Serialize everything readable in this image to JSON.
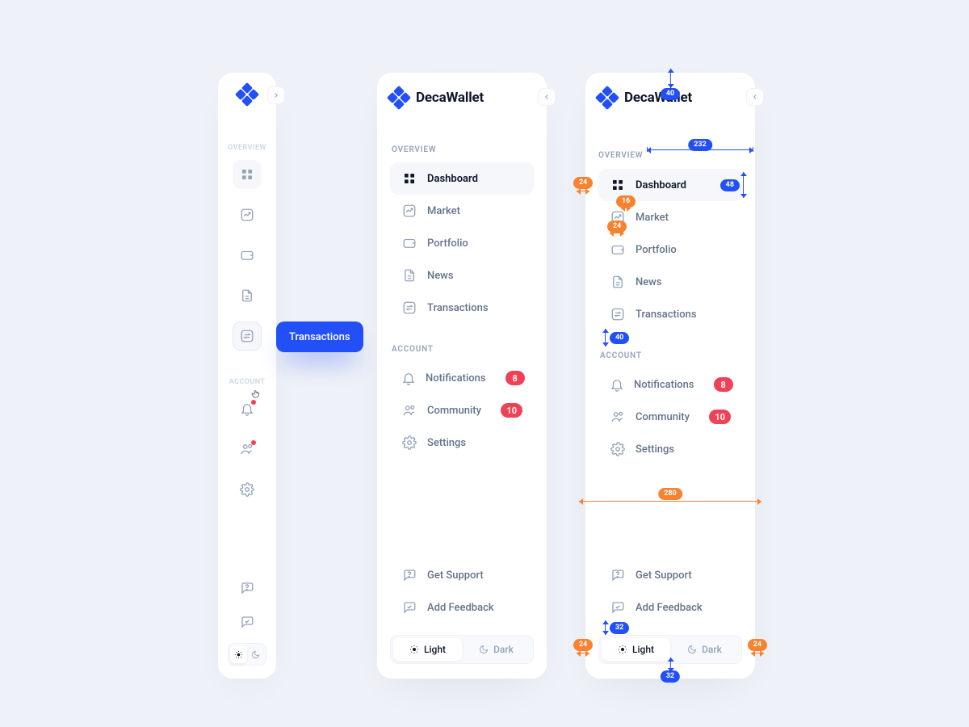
{
  "brand": {
    "name": "DecaWallet"
  },
  "sections": {
    "overview": "OVERVIEW",
    "account": "ACCOUNT"
  },
  "nav": {
    "dashboard": "Dashboard",
    "market": "Market",
    "portfolio": "Portfolio",
    "news": "News",
    "transactions": "Transactions",
    "notifications": "Notifications",
    "community": "Community",
    "settings": "Settings",
    "support": "Get Support",
    "feedback": "Add Feedback"
  },
  "badges": {
    "notifications": "8",
    "community": "10"
  },
  "theme": {
    "light": "Light",
    "dark": "Dark"
  },
  "collapsed_tooltip": {
    "label_path": "nav.transactions"
  },
  "spec": {
    "top_gap": "40",
    "row_w": "232",
    "row_h": "48",
    "side_pad": "24",
    "icon_gap": "16",
    "icon_pad": "24",
    "sect_gap": "40",
    "panel_w": "280",
    "ftr_gap_top": "32",
    "ftr_gap_bot": "32",
    "ftr_pad_l": "24",
    "ftr_pad_r": "24"
  }
}
